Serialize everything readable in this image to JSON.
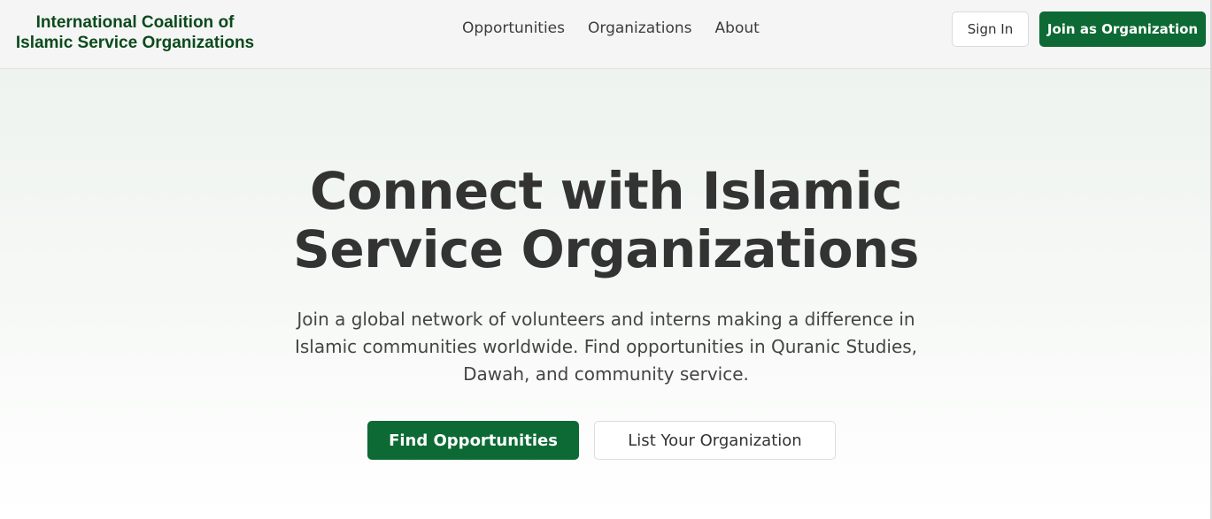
{
  "header": {
    "brand_line1": "International Coalition of",
    "brand_line2": "Islamic Service Organizations",
    "nav": [
      {
        "label": "Opportunities"
      },
      {
        "label": "Organizations"
      },
      {
        "label": "About"
      }
    ],
    "sign_in_label": "Sign In",
    "join_label": "Join as Organization"
  },
  "hero": {
    "title_line1": "Connect with Islamic",
    "title_line2": "Service Organizations",
    "subtitle_line1": "Join a global network of volunteers and interns making a difference in",
    "subtitle_line2": "Islamic communities worldwide. Find opportunities in Quranic Studies,",
    "subtitle_line3": "Dawah, and community service.",
    "primary_cta": "Find Opportunities",
    "secondary_cta": "List Your Organization"
  },
  "colors": {
    "brand_green": "#0d6a34",
    "brand_text_green": "#0b4a1c",
    "header_bg": "#f5f5f5",
    "text_dark": "#333333"
  }
}
